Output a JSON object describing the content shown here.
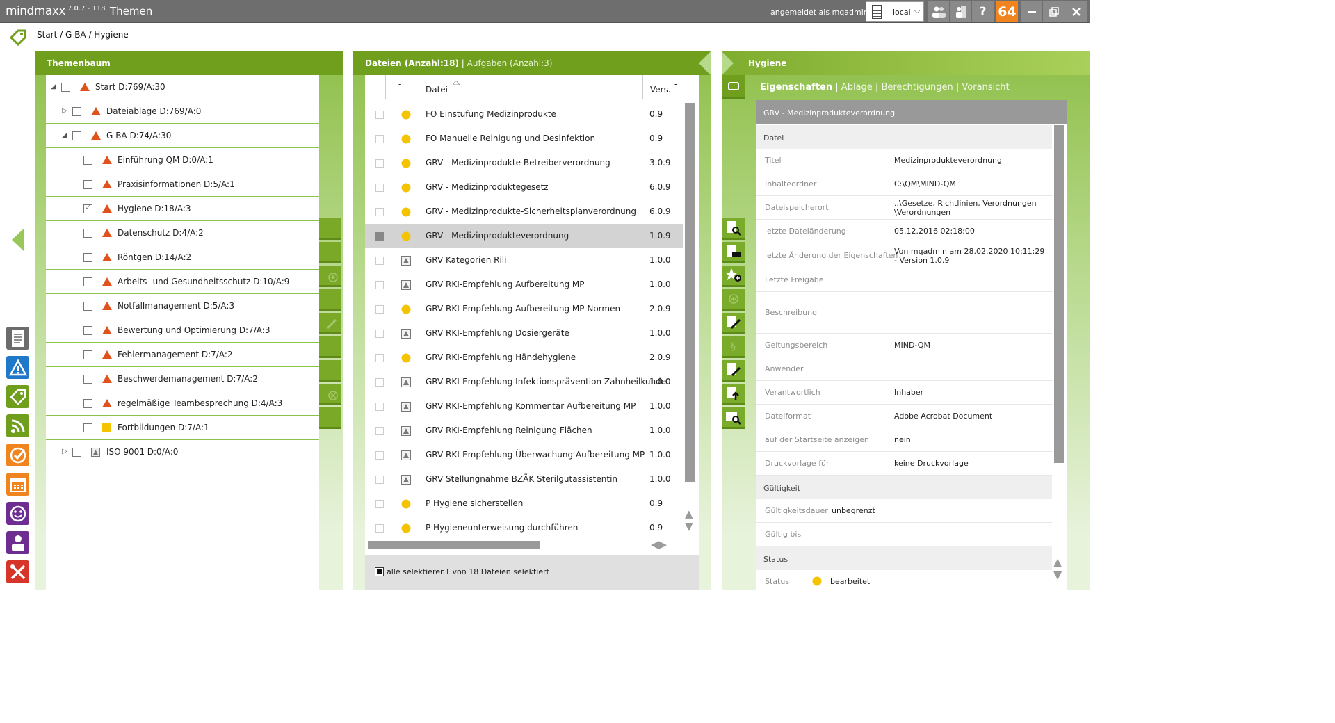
{
  "app": {
    "brand": "mindmaxx",
    "version": "7.0.7 - 118",
    "module_title": "Themen",
    "logged_in_text": "angemeldet als mqadmin",
    "server": "local",
    "badge_count": "64",
    "help_label": "?"
  },
  "breadcrumb": "Start / G-BA / Hygiene",
  "tree_panel": {
    "title": "Themenbaum",
    "nodes": [
      {
        "label": "Start D:769/A:30",
        "expander": "◢",
        "checked": false
      },
      {
        "label": "Dateiablage D:769/A:0",
        "expander": "▷",
        "checked": false
      },
      {
        "label": "G-BA D:74/A:30",
        "expander": "◢",
        "checked": false
      },
      {
        "label": "Einführung QM D:0/A:1",
        "checked": false
      },
      {
        "label": "Praxisinformationen D:5/A:1",
        "checked": false
      },
      {
        "label": "Hygiene D:18/A:3",
        "checked": true
      },
      {
        "label": "Datenschutz D:4/A:2",
        "checked": false
      },
      {
        "label": "Röntgen D:14/A:2",
        "checked": false
      },
      {
        "label": "Arbeits- und Gesundheitsschutz D:10/A:9",
        "checked": false
      },
      {
        "label": "Notfallmanagement D:5/A:3",
        "checked": false
      },
      {
        "label": "Bewertung und Optimierung D:7/A:3",
        "checked": false
      },
      {
        "label": "Fehlermanagement D:7/A:2",
        "checked": false
      },
      {
        "label": "Beschwerdemanagement D:7/A:2",
        "checked": false
      },
      {
        "label": "regelmäßige Teambesprechung D:4/A:3",
        "checked": false
      },
      {
        "label": "Fortbildungen D:7/A:1",
        "checked": false
      },
      {
        "label": "ISO 9001 D:0/A:0",
        "expander": "▷",
        "checked": false
      }
    ]
  },
  "files_panel": {
    "tab_files": "Dateien (Anzahl:18)",
    "tab_tasks": "Aufgaben (Anzahl:3)",
    "col_status": "-",
    "col_name": "Datei",
    "col_version": "Vers.",
    "col_more": "-",
    "files": [
      {
        "name": "FO Einstufung Medizinprodukte",
        "version": "0.9",
        "status": "dot"
      },
      {
        "name": "FO Manuelle Reinigung und Desinfektion",
        "version": "0.9",
        "status": "dot"
      },
      {
        "name": "GRV - Medizinprodukte-Betreiberverordnung",
        "version": "3.0.9",
        "status": "dot"
      },
      {
        "name": "GRV - Medizinproduktegesetz",
        "version": "6.0.9",
        "status": "dot"
      },
      {
        "name": "GRV - Medizinprodukte-Sicherheitsplanverordnung",
        "version": "6.0.9",
        "status": "dot"
      },
      {
        "name": "GRV - Medizinprodukteverordnung",
        "version": "1.0.9",
        "status": "dot",
        "selected": true
      },
      {
        "name": "GRV Kategorien Rili",
        "version": "1.0.0",
        "status": "tri"
      },
      {
        "name": "GRV RKI-Empfehlung Aufbereitung MP",
        "version": "1.0.0",
        "status": "tri"
      },
      {
        "name": "GRV RKI-Empfehlung Aufbereitung MP Normen",
        "version": "2.0.9",
        "status": "dot"
      },
      {
        "name": "GRV RKI-Empfehlung Dosiergeräte",
        "version": "1.0.0",
        "status": "tri"
      },
      {
        "name": "GRV RKI-Empfehlung Händehygiene",
        "version": "2.0.9",
        "status": "dot"
      },
      {
        "name": "GRV RKI-Empfehlung Infektionsprävention Zahnheilkunde",
        "version": "1.0.0",
        "status": "tri"
      },
      {
        "name": "GRV RKI-Empfehlung Kommentar Aufbereitung MP",
        "version": "1.0.0",
        "status": "tri"
      },
      {
        "name": "GRV RKI-Empfehlung Reinigung Flächen",
        "version": "1.0.0",
        "status": "tri"
      },
      {
        "name": "GRV RKI-Empfehlung Überwachung Aufbereitung MP",
        "version": "1.0.0",
        "status": "tri"
      },
      {
        "name": "GRV Stellungnahme BZÄK Sterilgutassistentin",
        "version": "1.0.0",
        "status": "tri"
      },
      {
        "name": "P Hygiene sicherstellen",
        "version": "0.9",
        "status": "dot"
      },
      {
        "name": "P Hygieneunterweisung durchführen",
        "version": "0.9",
        "status": "dot"
      }
    ],
    "select_all": "alle selektieren",
    "selection_info": "1 von 18 Dateien selektiert"
  },
  "detail_panel": {
    "title": "Hygiene",
    "tabs": [
      "Eigenschaften",
      "Ablage",
      "Berechtigungen",
      "Voransicht"
    ],
    "doc_title": "GRV - Medizinprodukteverordnung",
    "section_file": "Datei",
    "props": [
      {
        "key": "Titel",
        "value": "Medizinprodukteverordnung"
      },
      {
        "key": "Inhalteordner",
        "value": "C:\\QM\\MIND-QM"
      },
      {
        "key": "Dateispeicherort",
        "value": "..\\Gesetze, Richtlinien, Verordnungen \\Verordnungen"
      },
      {
        "key": "letzte Dateiänderung",
        "value": "05.12.2016 02:18:00"
      },
      {
        "key": "letzte Änderung der Eigenschaften",
        "value": "Von mqadmin am 28.02.2020 10:11:29 - Version 1.0.9"
      },
      {
        "key": "Letzte Freigabe",
        "value": ""
      },
      {
        "key": "Beschreibung",
        "value": ""
      },
      {
        "key": "Geltungsbereich",
        "value": "MIND-QM"
      },
      {
        "key": "Anwender",
        "value": ""
      },
      {
        "key": "Verantwortlich",
        "value": "Inhaber"
      },
      {
        "key": "Dateiformat",
        "value": "Adobe Acrobat Document"
      },
      {
        "key": "auf der Startseite anzeigen",
        "value": "nein"
      },
      {
        "key": "Druckvorlage für",
        "value": "keine Druckvorlage"
      }
    ],
    "section_validity": "Gültigkeit",
    "validity_props": [
      {
        "key": "Gültigkeitsdauer",
        "value": "unbegrenzt"
      },
      {
        "key": "Gültig bis",
        "value": ""
      }
    ],
    "section_status": "Status",
    "status_key": "Status",
    "status_value": "bearbeitet"
  },
  "colors": {
    "accent_green": "#6f9f1c",
    "status_red": "#e0521c",
    "status_yellow": "#f5c400",
    "badge_orange": "#f08520"
  }
}
